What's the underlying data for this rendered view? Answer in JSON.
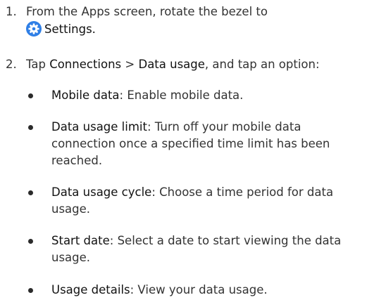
{
  "steps": [
    {
      "number": "1.",
      "text_before": "From the Apps screen, rotate the bezel to",
      "settings_label": "Settings."
    },
    {
      "number": "2.",
      "text_prefix": "Tap ",
      "connections_label": "Connections",
      "separator": " > ",
      "data_usage_label": "Data usage",
      "text_suffix": ", and tap an option:"
    }
  ],
  "options": [
    {
      "term": "Mobile data",
      "description": ": Enable mobile data."
    },
    {
      "term": "Data usage limit",
      "description": ": Turn off your mobile data connection once a specified time limit has been reached."
    },
    {
      "term": "Data usage cycle",
      "description": ": Choose a time period for data usage."
    },
    {
      "term": "Start date",
      "description": ": Select a date to start viewing the data usage."
    },
    {
      "term": "Usage details",
      "description": ": View your data usage."
    }
  ],
  "colors": {
    "text": "#333333",
    "icon_blue": "#2f7fe6"
  },
  "icons": {
    "settings": "gear-icon"
  }
}
